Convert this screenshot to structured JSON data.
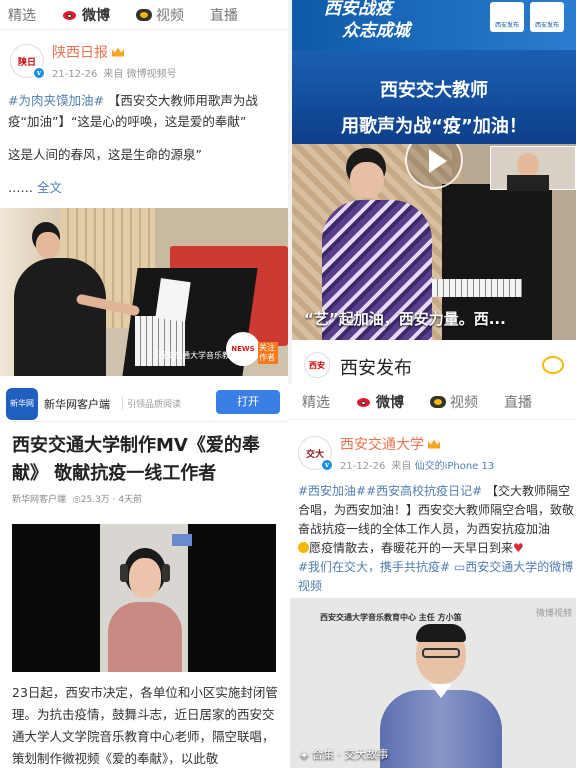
{
  "colors": {
    "weibo_orange": "#eb7350",
    "link_blue": "#507daf",
    "banner_blue": "#0e5aa8",
    "xinhua_blue": "#1f5fbf",
    "open_button": "#3b7ee6"
  },
  "top_left": {
    "tabs": [
      {
        "label": "精选",
        "icon": ""
      },
      {
        "label": "微博",
        "icon": "weibo-icon"
      },
      {
        "label": "视频",
        "icon": "video-icon"
      },
      {
        "label": "直播",
        "icon": ""
      }
    ],
    "active_tab": "微博",
    "author": {
      "name": "陕西日报",
      "date": "21-12-26",
      "source": "来自 微博视频号",
      "avatar_text": "陕日"
    },
    "text_line1_tag": "#为肉夹馍加油#",
    "text_line1_rest": " 【西安交大教师用歌声为战疫“加油”】“这是心的呼唤，这是爱的奉献”",
    "text_line2": "这是人间的春风，这是生命的源泉”",
    "text_line3_prefix": "……",
    "text_line3_link": "全文",
    "video_caption": "西安交通大学音乐教育中",
    "follow_badge": "关注作者",
    "news_logo": "NEWS"
  },
  "top_right": {
    "banner_title1": "西安战疫",
    "banner_title2": "众志成城",
    "badge1": "西安发布",
    "badge2": "西安发布",
    "headline1": "西安交大教师",
    "headline2": "用歌声为战“疫”加油！",
    "caption": "“艺”起加油，西安力量。西...",
    "account_name": "西安发布",
    "avatar_text": "西安"
  },
  "bottom_left": {
    "app_name": "新华网客户端",
    "app_meta": "引领品质阅读",
    "open_label": "打开",
    "logo_text": "新华网",
    "title": "西安交通大学制作MV《爱的奉献》 敬献抗疫一线工作者",
    "source": "新华网客户端",
    "views": "25.3万",
    "time": "4天前",
    "body": "23日起，西安市决定，各单位和小区实施封闭管理。为抗击疫情，鼓舞斗志，近日居家的西安交通大学人文学院音乐教育中心老师，隔空联唱，策划制作微视频《爱的奉献》，以此敬"
  },
  "bottom_right": {
    "tabs": [
      {
        "label": "精选",
        "icon": ""
      },
      {
        "label": "微博",
        "icon": "weibo-icon"
      },
      {
        "label": "视频",
        "icon": "video-icon"
      },
      {
        "label": "直播",
        "icon": ""
      }
    ],
    "active_tab": "微博",
    "author": {
      "name": "西安交通大学",
      "date": "21-12-26",
      "source_prefix": "来自",
      "device": "仙交的iPhone 13",
      "avatar_text": "交大"
    },
    "tags": "#西安加油##西安高校抗疫日记#",
    "text1": " 【交大教师隔空合唱，为西安加油！】西安交大教师隔空合唱，致敬奋战抗疫一线的全体工作人员，为西安抗疫加油",
    "text2": "愿疫情散去，春暖花开的一天早日到来",
    "tag2": "#我们在交大，携手共抗疫#",
    "link": "西安交通大学的微博视频",
    "video_header": "西安交通大学音乐教育中心 主任 方小笛",
    "watermark": "微博视频",
    "collection": "合集 · 交大故事"
  }
}
